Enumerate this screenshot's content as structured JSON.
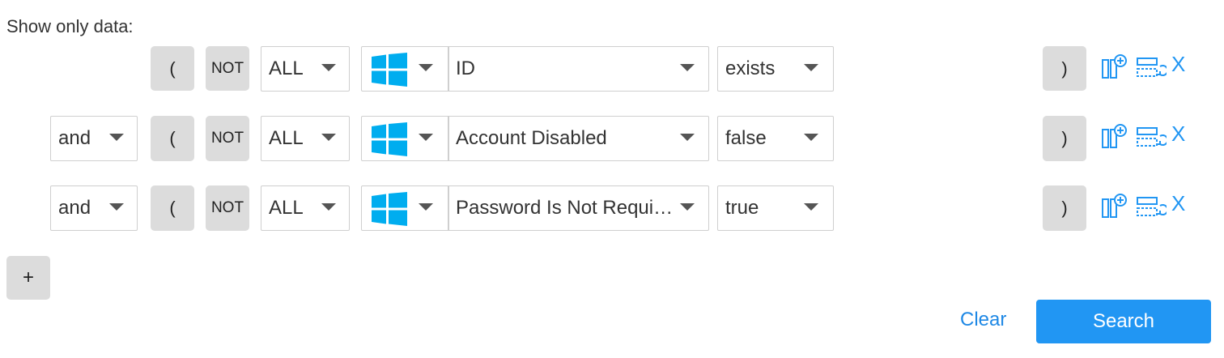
{
  "header": {
    "title": "Show only data:"
  },
  "rows": [
    {
      "connector": null,
      "open_paren": "(",
      "not_label": "NOT",
      "quantifier": "ALL",
      "field": "ID",
      "operator": "exists",
      "close_paren": ")"
    },
    {
      "connector": "and",
      "open_paren": "(",
      "not_label": "NOT",
      "quantifier": "ALL",
      "field": "Account Disabled",
      "operator": "false",
      "close_paren": ")"
    },
    {
      "connector": "and",
      "open_paren": "(",
      "not_label": "NOT",
      "quantifier": "ALL",
      "field": "Password Is Not Requi…",
      "operator": "true",
      "close_paren": ")"
    }
  ],
  "icons": {
    "source": "windows-logo-icon",
    "row_actions": [
      "add-column-icon",
      "toggle-row-icon",
      "close-icon"
    ]
  },
  "actions": {
    "add_label": "+",
    "clear_label": "Clear",
    "search_label": "Search",
    "remove_label": "X"
  },
  "colors": {
    "accent": "#2196f3",
    "link": "#1e88e5",
    "windows": "#00adef",
    "button_bg": "#dcdcdc"
  }
}
